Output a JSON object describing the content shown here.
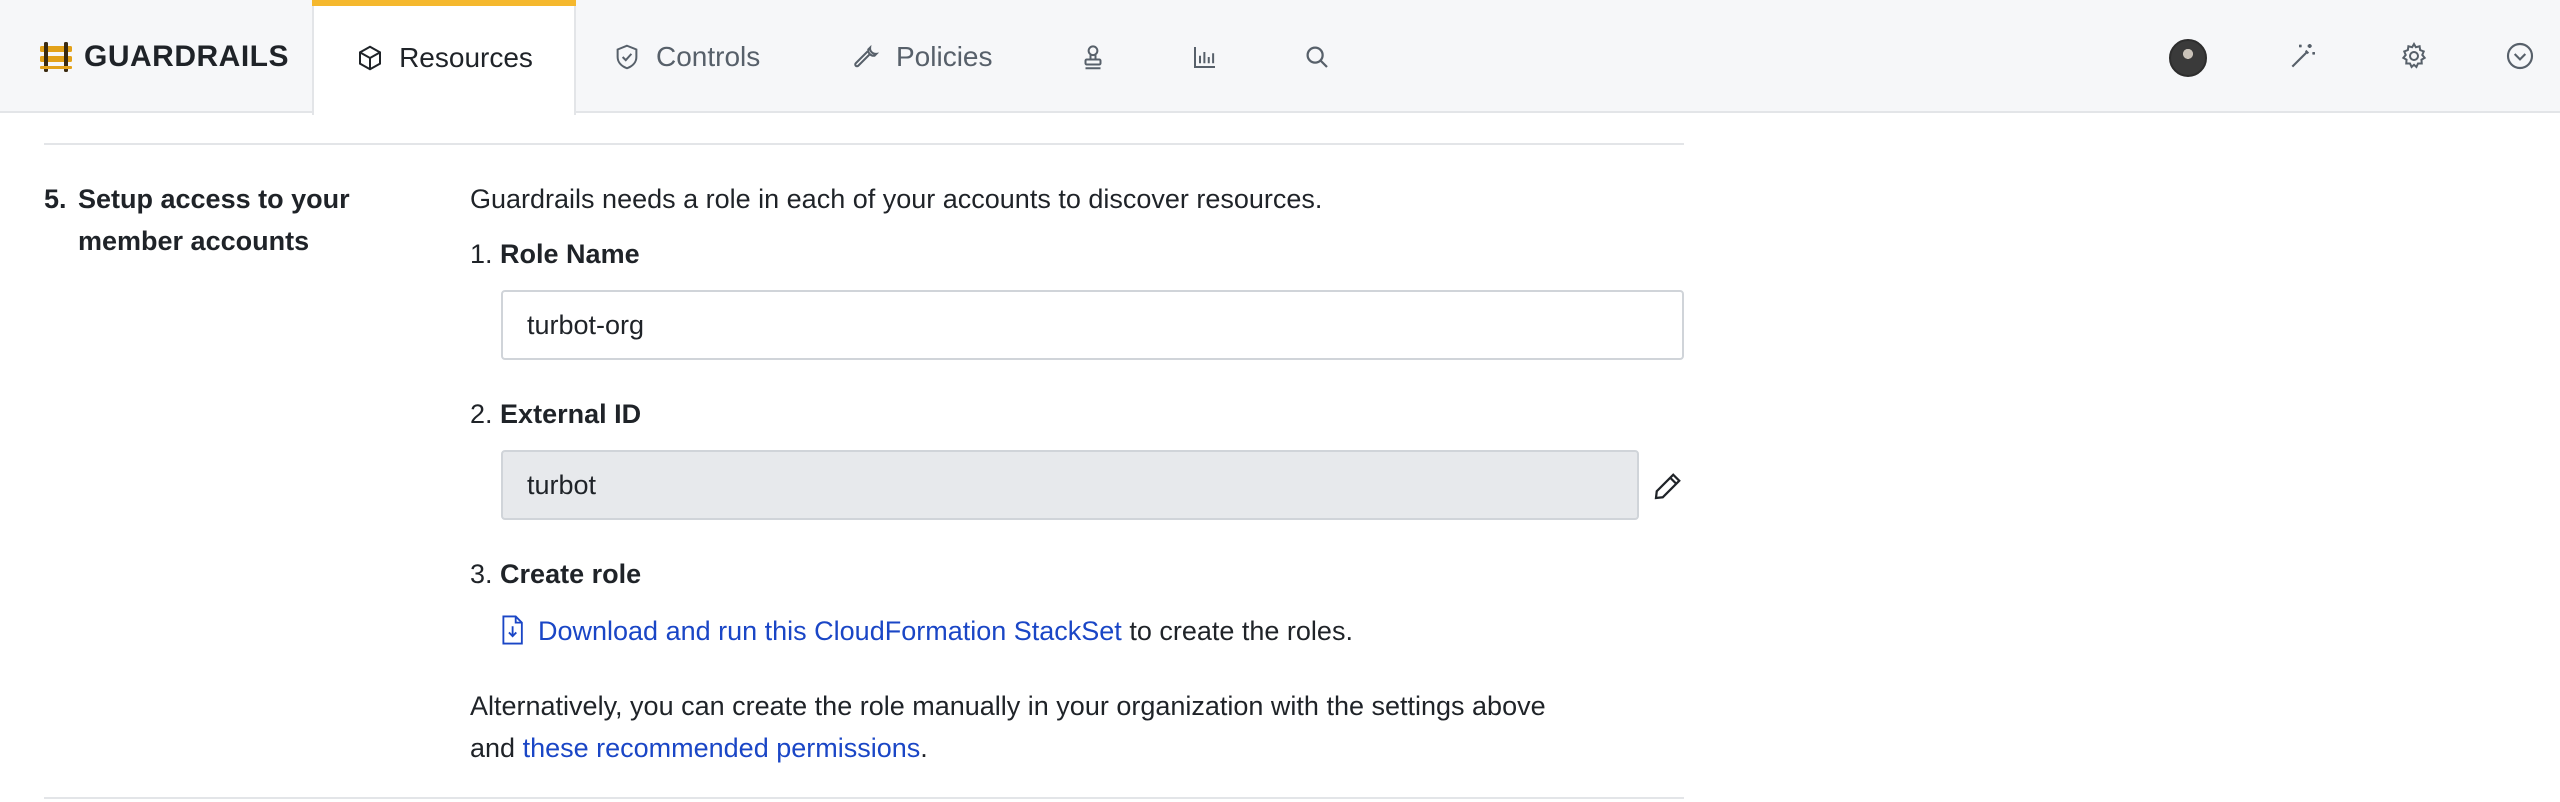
{
  "brand": {
    "name": "GUARDRAILS",
    "logo_color": "#e3a21a"
  },
  "tabs": [
    {
      "label": "Resources",
      "icon": "cube-icon",
      "active": true
    },
    {
      "label": "Controls",
      "icon": "shield-check-icon"
    },
    {
      "label": "Policies",
      "icon": "wrench-icon"
    },
    {
      "icon": "stamp-icon"
    },
    {
      "icon": "bar-chart-icon"
    },
    {
      "icon": "search-icon"
    }
  ],
  "header_right": [
    "avatar",
    "magic-wand-icon",
    "gear-icon",
    "chevron-down-circle-icon"
  ],
  "accent_color": "#f5b82e",
  "link_color": "#1a46c6",
  "step": {
    "number": "5.",
    "title_line1": "Setup access to your",
    "title_line2": "member accounts",
    "intro": "Guardrails needs a role in each of your accounts to discover resources.",
    "role_name": {
      "number": "1.",
      "label": "Role Name",
      "value": "turbot-org"
    },
    "external_id": {
      "number": "2.",
      "label": "External ID",
      "value": "turbot"
    },
    "create_role": {
      "number": "3.",
      "label": "Create role",
      "link_text": "Download and run this CloudFormation StackSet",
      "suffix": "to create the roles."
    },
    "alternative": {
      "line1": "Alternatively, you can create the role manually in your organization with the settings above",
      "line2_prefix": "and",
      "link_text": "these recommended permissions",
      "line2_suffix": "."
    }
  }
}
